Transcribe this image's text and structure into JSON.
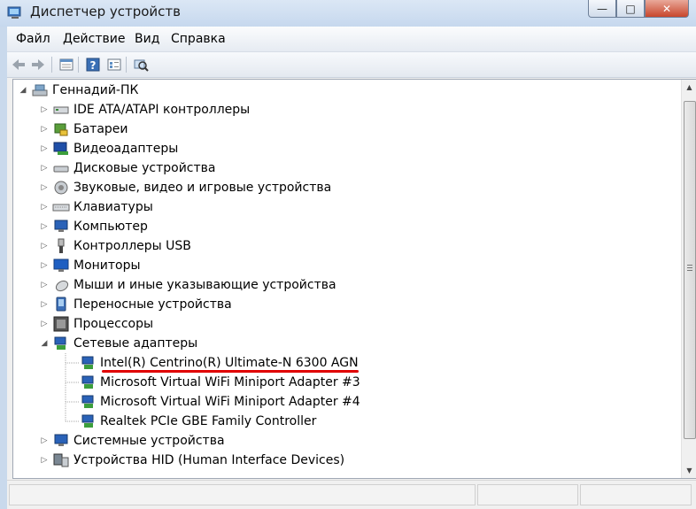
{
  "window": {
    "title": "Диспетчер устройств",
    "icon": "device-manager-icon"
  },
  "menu": {
    "items": [
      "Файл",
      "Действие",
      "Вид",
      "Справка"
    ]
  },
  "toolbar": {
    "buttons": [
      "back-arrow-icon",
      "forward-arrow-icon",
      "show-hide-tree-icon",
      "help-icon",
      "properties-icon",
      "scan-hardware-icon"
    ]
  },
  "tree": {
    "root": "Геннадий-ПК",
    "categories": [
      {
        "label": "IDE ATA/ATAPI контроллеры",
        "icon": "ide-controller-icon"
      },
      {
        "label": "Батареи",
        "icon": "battery-icon"
      },
      {
        "label": "Видеоадаптеры",
        "icon": "display-adapter-icon"
      },
      {
        "label": "Дисковые устройства",
        "icon": "disk-drive-icon"
      },
      {
        "label": "Звуковые, видео и игровые устройства",
        "icon": "speaker-icon"
      },
      {
        "label": "Клавиатуры",
        "icon": "keyboard-icon"
      },
      {
        "label": "Компьютер",
        "icon": "computer-icon"
      },
      {
        "label": "Контроллеры USB",
        "icon": "usb-icon"
      },
      {
        "label": "Мониторы",
        "icon": "monitor-icon"
      },
      {
        "label": "Мыши и иные указывающие устройства",
        "icon": "mouse-icon"
      },
      {
        "label": "Переносные устройства",
        "icon": "portable-device-icon"
      },
      {
        "label": "Процессоры",
        "icon": "processor-icon"
      },
      {
        "label": "Сетевые адаптеры",
        "icon": "network-adapter-icon"
      }
    ],
    "network_adapters": [
      "Intel(R) Centrino(R) Ultimate-N 6300 AGN",
      "Microsoft Virtual WiFi Miniport Adapter #3",
      "Microsoft Virtual WiFi Miniport Adapter #4",
      "Realtek PCIe GBE Family Controller"
    ],
    "after": [
      {
        "label": "Системные устройства",
        "icon": "system-device-icon"
      },
      {
        "label": "Устройства HID (Human Interface Devices)",
        "icon": "hid-icon"
      }
    ]
  },
  "colors": {
    "highlight_underline": "#e00000",
    "accent": "#3c7fb1"
  }
}
